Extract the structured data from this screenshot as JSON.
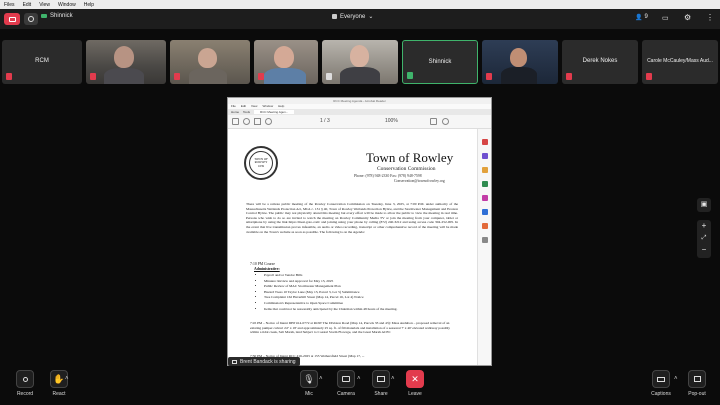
{
  "menu": [
    "Files",
    "Edit",
    "View",
    "Window",
    "Help"
  ],
  "titlebar": {
    "sharer_name": "Shinnick",
    "view_label": "Everyone",
    "participant_count": "9"
  },
  "participants": [
    {
      "name": "RCM",
      "video": false,
      "muted": true
    },
    {
      "name": "",
      "video": true,
      "muted": true
    },
    {
      "name": "",
      "video": true,
      "muted": true
    },
    {
      "name": "",
      "video": true,
      "muted": true
    },
    {
      "name": "",
      "video": true,
      "muted": false
    },
    {
      "name": "Shinnick",
      "video": false,
      "muted": false
    },
    {
      "name": "",
      "video": true,
      "muted": true
    },
    {
      "name": "Derek Nokes",
      "video": false,
      "muted": true
    },
    {
      "name": "Carole McCauley/Mass Aud...",
      "video": false,
      "muted": true
    }
  ],
  "document": {
    "window_title": "RCC Meeting Agenda - Acrobat Reader",
    "menu": [
      "File",
      "Edit",
      "View",
      "Window",
      "Help"
    ],
    "tabs": [
      "Home",
      "Tools",
      "RCC Meeting Agen..."
    ],
    "zoom": "100%",
    "page_indicator": "1 / 3",
    "seal_text": "TOWN OF ROWLEY 1639",
    "heading": "Town of Rowley",
    "subheading": "Conservation Commission",
    "phone": "Phone: (978) 948-2330  Fax: (978) 948-7598",
    "email": "Conservation@townofrowley.org",
    "intro": "There will be a remote public meeting of the Rowley Conservation Commission on Tuesday, June 3, 2025, at 7:00 P.M. under authority of the Massachusetts Wetlands Protection Act, MGL c. 131 § 40, Town of Rowley Wetlands Protection Bylaw, and the Stormwater Management and Erosion Control Bylaw. The public may not physically attend this meeting but every effort will be made to allow the public to view the meeting in real time. Persons who wish to do so are invited to watch the meeting on Rowley Community Media TV or join the meeting from your computer, tablet or smartphone by using the link https://meet.goto.com/ and joining using your phone by calling (872) 240-3212 and using access code 304-252-005. In the event that live transmission proves infeasible, an audio or video recording, transcript or other comprehensive record of the meeting will be made available on the Town's website as soon as possible. The following is on the Agenda:",
    "agenda_time": "7:10 PM     Course",
    "admin_heading": "Administrative:",
    "admin_items": [
      "Payroll and/or Vendor Bills",
      "Minutes: Review and Approval for May 13, 2025",
      "Public Review of MAC Stormwater Management Plan",
      "Hazard Trees 10 Taylor Lane (May 13, Parcel 3, Lot 5) Submittance",
      "Tree Complaint 162 Haverhill Street (Map 14, Parcel 16, Lot 4) Notice",
      "Commission's Representative to Open Space Committee",
      "Items that could not be reasonably anticipated by the Chairman within 48 hours of the meeting."
    ],
    "hearing1": "7:45 PM – Notice of Intent DEP #14-0772 at ROW The Division Road (Map 14, Parcels 33 and 43): Mass Audubon – proposed removal of an existing pumper culvert 24\" x 18' and approximately 25 sq. ft. of fill materials and installation of a seasonal 7' x 40' elevated walkway possibly within a tidal creek, Salt Marsh, land Subject to Coastal Storm Flowage, and the Great Marsh ACEC",
    "hearing2": "7:50 PM – Notice of Intent RCC #16-2025 at 155 Wethersfield Street (Map 17, ..."
  },
  "sharing_banner": "Brent Bandack is sharing",
  "controls": {
    "record": "Record",
    "react": "React",
    "mic": "Mic",
    "camera": "Camera",
    "share": "Share",
    "leave": "Leave",
    "captions": "Captions",
    "popout": "Pop-out"
  },
  "colors": {
    "accent": "#e23b4d",
    "mute_red": "#e23b4d",
    "speaking_green": "#3fb36b"
  }
}
